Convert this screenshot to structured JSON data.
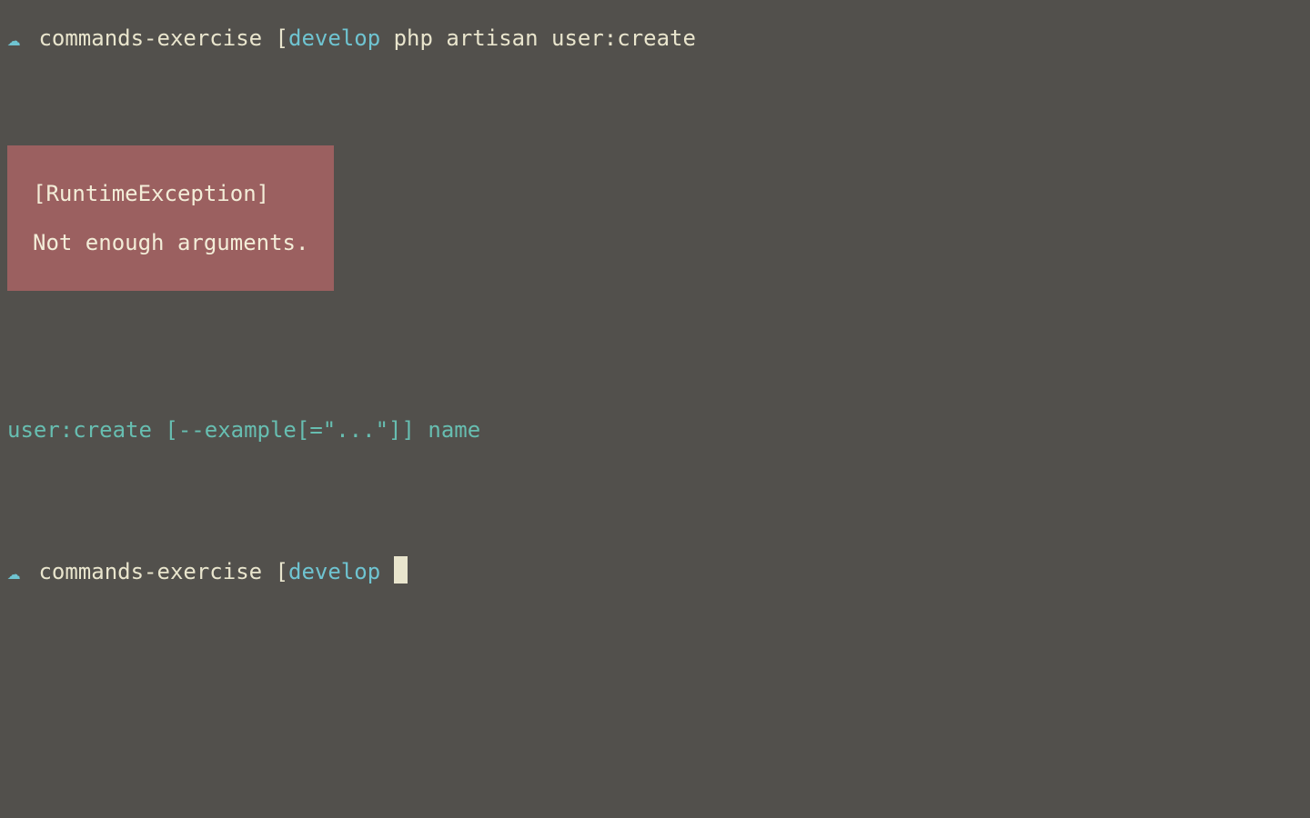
{
  "prompt1": {
    "icon": "☁",
    "dir": "commands-exercise",
    "bracket": "[",
    "branch": "develop",
    "command": "php artisan user:create"
  },
  "error": {
    "title": "[RuntimeException]",
    "message": "Not enough arguments."
  },
  "usage": "user:create [--example[=\"...\"]] name",
  "prompt2": {
    "icon": "☁",
    "dir": "commands-exercise",
    "bracket": "[",
    "branch": "develop"
  }
}
